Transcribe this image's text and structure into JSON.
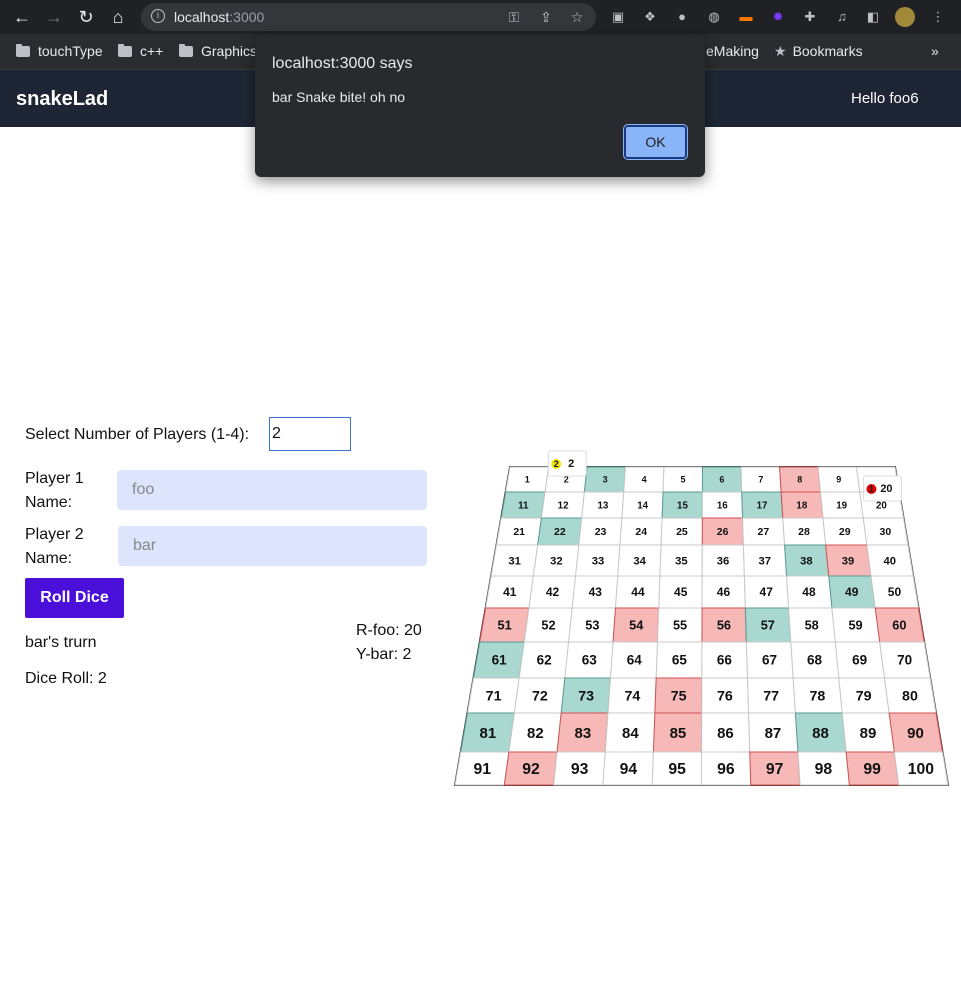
{
  "browser": {
    "url_host": "localhost",
    "url_port": ":3000",
    "bookmarks": [
      "touchType",
      "c++",
      "Graphics",
      "eMaking",
      "Bookmarks"
    ],
    "more_bookmarks": "»"
  },
  "app": {
    "brand": "snakeLad",
    "greeting": "Hello foo6"
  },
  "dialog": {
    "title": "localhost:3000 says",
    "message": "bar Snake bite! oh no",
    "ok_label": "OK"
  },
  "setup": {
    "players_label": "Select Number of Players (1-4):",
    "players_value": "2",
    "player1_label_line1": "Player 1",
    "player1_label_line2": "Name:",
    "player1_value": "foo",
    "player2_label_line1": "Player 2",
    "player2_label_line2": "Name:",
    "player2_value": "bar"
  },
  "game": {
    "roll_label": "Roll Dice",
    "turn_text": "bar's trurn",
    "dice_roll": "Dice Roll: 2",
    "positions": [
      "R-foo: 20",
      "Y-bar: 2"
    ]
  },
  "board": {
    "rows": 10,
    "cols": 10,
    "green_cells": [
      3,
      6,
      11,
      15,
      17,
      22,
      38,
      49,
      57,
      61,
      73,
      81,
      88
    ],
    "red_cells": [
      8,
      18,
      26,
      39,
      51,
      54,
      56,
      60,
      75,
      83,
      85,
      90,
      92,
      97,
      99
    ],
    "colors": {
      "green": "#a8d8d0",
      "red": "#f7b8b8",
      "red_border": "#d05050",
      "green_border": "#5a9a90"
    },
    "tokens": [
      {
        "label": "1",
        "cell": 20,
        "color": "#e00000"
      },
      {
        "label": "2",
        "cell": 2,
        "color": "#f2e600"
      }
    ]
  }
}
